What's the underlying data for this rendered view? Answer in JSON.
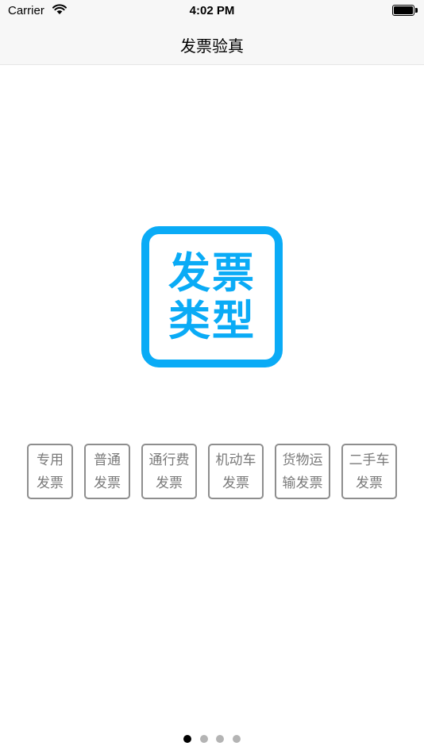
{
  "status_bar": {
    "carrier": "Carrier",
    "time": "4:02 PM"
  },
  "nav": {
    "title": "发票验真"
  },
  "logo": {
    "line1": "发票",
    "line2": "类型",
    "color": "#0aabf6"
  },
  "tags": [
    {
      "line1": "专用",
      "line2": "发票"
    },
    {
      "line1": "普通",
      "line2": "发票"
    },
    {
      "line1": "通行费",
      "line2": "发票"
    },
    {
      "line1": "机动车",
      "line2": "发票"
    },
    {
      "line1": "货物运",
      "line2": "输发票"
    },
    {
      "line1": "二手车",
      "line2": "发票"
    }
  ],
  "pager": {
    "count": 4,
    "current": 1
  }
}
